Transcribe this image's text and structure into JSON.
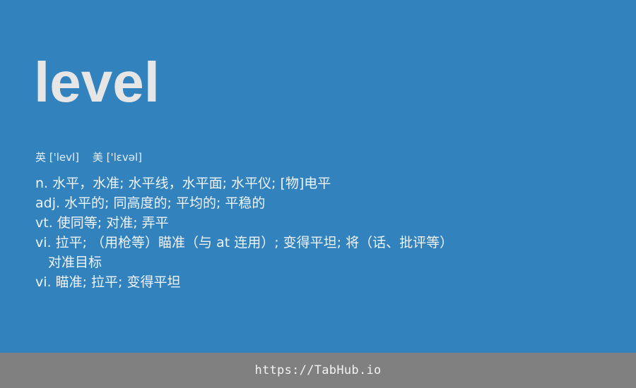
{
  "entry": {
    "word": "level",
    "phonetics": [
      {
        "label": "英 ['levl]"
      },
      {
        "label": "美 ['lɛvəl]"
      }
    ],
    "definitions": [
      {
        "text": "n. 水平，水准; 水平线，水平面; 水平仪; [物]电平",
        "indent": false
      },
      {
        "text": "adj. 水平的; 同高度的; 平均的; 平稳的",
        "indent": false
      },
      {
        "text": "vt. 使同等; 对准; 弄平",
        "indent": false
      },
      {
        "text": "vi. 拉平; （用枪等）瞄准（与 at 连用）; 变得平坦; 将（话、批评等）",
        "indent": false
      },
      {
        "text": "对准目标",
        "indent": true
      },
      {
        "text": "vi. 瞄准; 拉平; 变得平坦",
        "indent": false
      }
    ]
  },
  "footer": {
    "link_text": "https://TabHub.io"
  },
  "colors": {
    "background": "#3182bd",
    "footer_background": "#808080",
    "word_color": "#e6e6e6"
  }
}
